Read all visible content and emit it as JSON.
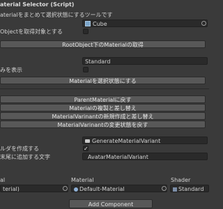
{
  "component": {
    "title": "aterial Selector (Script)",
    "description": "aterialをまとめて選択状態にするツールです"
  },
  "root_object": {
    "value": "Cube"
  },
  "root_as_target": {
    "label": "Objectを取得対象とする"
  },
  "buttons": {
    "get_materials": "RootObject下のMaterialの取得",
    "select_materials": "Materialを選択状態にする",
    "back_to_parent": "ParentMaterialに戻す",
    "duplicate_replace": "Materialの複製と差し替え",
    "create_variant": "MaterialVarinantの新規作成と差し替え",
    "revert_variant": "MaterialVarinantの変更状態を戻す"
  },
  "shader_filter": {
    "value": "Standard"
  },
  "show_option": {
    "label": "みを表示"
  },
  "variant_settings": {
    "folder_value": "GenerateMaterialVariant",
    "create_folder_label": "ルダを作成する",
    "suffix_label": "末尾に追加する文字",
    "suffix_value": "_AvatarMaterialVariant"
  },
  "table": {
    "headers": [
      "al",
      "Material",
      "Shader"
    ],
    "row": {
      "col1": "terial)",
      "material": "Default-Material",
      "shader": "Standard"
    }
  },
  "add_component": {
    "label": "Add Component"
  }
}
